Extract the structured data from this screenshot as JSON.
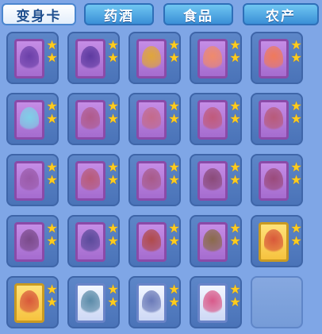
{
  "tabs": [
    {
      "label": "变身卡",
      "active": true
    },
    {
      "label": "药酒",
      "active": false
    },
    {
      "label": "食品",
      "active": false
    },
    {
      "label": "农产",
      "active": false
    }
  ],
  "colors": {
    "background": "#7fa6e6",
    "tab_active_text": "#1f4f8f",
    "star": "#ffcc1e",
    "card_purple": "#a56ccf",
    "card_gold": "#f6c33f",
    "card_white": "#e8eefb"
  },
  "cards": [
    {
      "frame": "purple",
      "sprite_color": "#6a3fa8",
      "stars": 2
    },
    {
      "frame": "purple",
      "sprite_color": "#5d3aa0",
      "stars": 2
    },
    {
      "frame": "purple",
      "sprite_color": "#e0a63a",
      "stars": 2
    },
    {
      "frame": "purple",
      "sprite_color": "#f08a6a",
      "stars": 2
    },
    {
      "frame": "purple",
      "sprite_color": "#f07a5a",
      "stars": 2
    },
    {
      "frame": "purple",
      "sprite_color": "#7ed0e8",
      "stars": 2
    },
    {
      "frame": "purple",
      "sprite_color": "#b05a8a",
      "stars": 2
    },
    {
      "frame": "purple",
      "sprite_color": "#c46a8a",
      "stars": 2
    },
    {
      "frame": "purple",
      "sprite_color": "#c05a7a",
      "stars": 2
    },
    {
      "frame": "purple",
      "sprite_color": "#b85a78",
      "stars": 2
    },
    {
      "frame": "purple",
      "sprite_color": "#9a5aa8",
      "stars": 2
    },
    {
      "frame": "purple",
      "sprite_color": "#b85a78",
      "stars": 2
    },
    {
      "frame": "purple",
      "sprite_color": "#a85a88",
      "stars": 2
    },
    {
      "frame": "purple",
      "sprite_color": "#8a4a78",
      "stars": 2
    },
    {
      "frame": "purple",
      "sprite_color": "#9a4a7a",
      "stars": 2
    },
    {
      "frame": "purple",
      "sprite_color": "#7a4a8a",
      "stars": 2
    },
    {
      "frame": "purple",
      "sprite_color": "#5a4a9a",
      "stars": 2
    },
    {
      "frame": "purple",
      "sprite_color": "#b04a4a",
      "stars": 2
    },
    {
      "frame": "purple",
      "sprite_color": "#8a6a4a",
      "stars": 2
    },
    {
      "frame": "gold",
      "sprite_color": "#d8583a",
      "stars": 2
    },
    {
      "frame": "gold",
      "sprite_color": "#d8583a",
      "stars": 2
    },
    {
      "frame": "white",
      "sprite_color": "#5a8aa8",
      "stars": 2
    },
    {
      "frame": "white",
      "sprite_color": "#6a7ab8",
      "stars": 2
    },
    {
      "frame": "white",
      "sprite_color": "#d85a8a",
      "stars": 2
    },
    {
      "frame": "empty",
      "sprite_color": "",
      "stars": 0
    }
  ]
}
